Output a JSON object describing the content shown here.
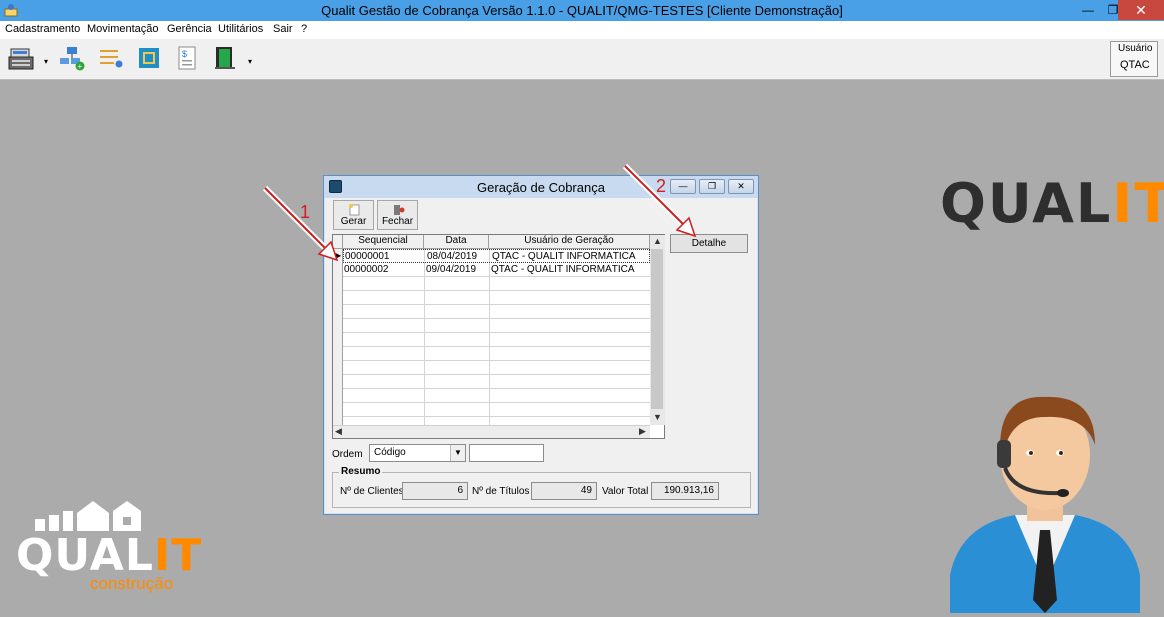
{
  "window": {
    "title": "Qualit Gestão de Cobrança Versão 1.1.0 - QUALIT/QMG-TESTES [Cliente Demonstração]",
    "minimize": "—",
    "restore": "❐",
    "close": "✕"
  },
  "menu": {
    "items": [
      "Cadastramento",
      "Movimentação",
      "Gerência",
      "Utilitários",
      "Sair",
      "?"
    ]
  },
  "toolbar": {
    "dropdown_arrow": "▾"
  },
  "user": {
    "label": "Usuário",
    "value": "QTAC"
  },
  "dialog": {
    "title": "Geração de Cobrança",
    "gerar_label": "Gerar",
    "fechar_label": "Fechar",
    "detalhe_label": "Detalhe",
    "columns": [
      "Sequencial",
      "Data",
      "Usuário de Geração"
    ],
    "rows": [
      {
        "seq": "00000001",
        "data": "08/04/2019",
        "usuario": "QTAC - QUALIT INFORMÁTICA"
      },
      {
        "seq": "00000002",
        "data": "09/04/2019",
        "usuario": "QTAC - QUALIT INFORMÁTICA"
      }
    ],
    "ordem_label": "Ordem",
    "ordem_value": "Código",
    "ordem_text": "",
    "resumo_label": "Resumo",
    "clientes_label": "Nº de Clientes",
    "clientes_value": "6",
    "titulos_label": "Nº de Títulos",
    "titulos_value": "49",
    "valor_label": "Valor Total",
    "valor_value": "190.913,16"
  },
  "annotations": {
    "one": "1",
    "two": "2"
  },
  "branding": {
    "logo_prefix": "QUAL",
    "logo_suffix": "IT",
    "corner_prefix": "QUAL",
    "corner_suffix": "IT",
    "corner_sub": "construção",
    "accent": "#ff8a00"
  }
}
